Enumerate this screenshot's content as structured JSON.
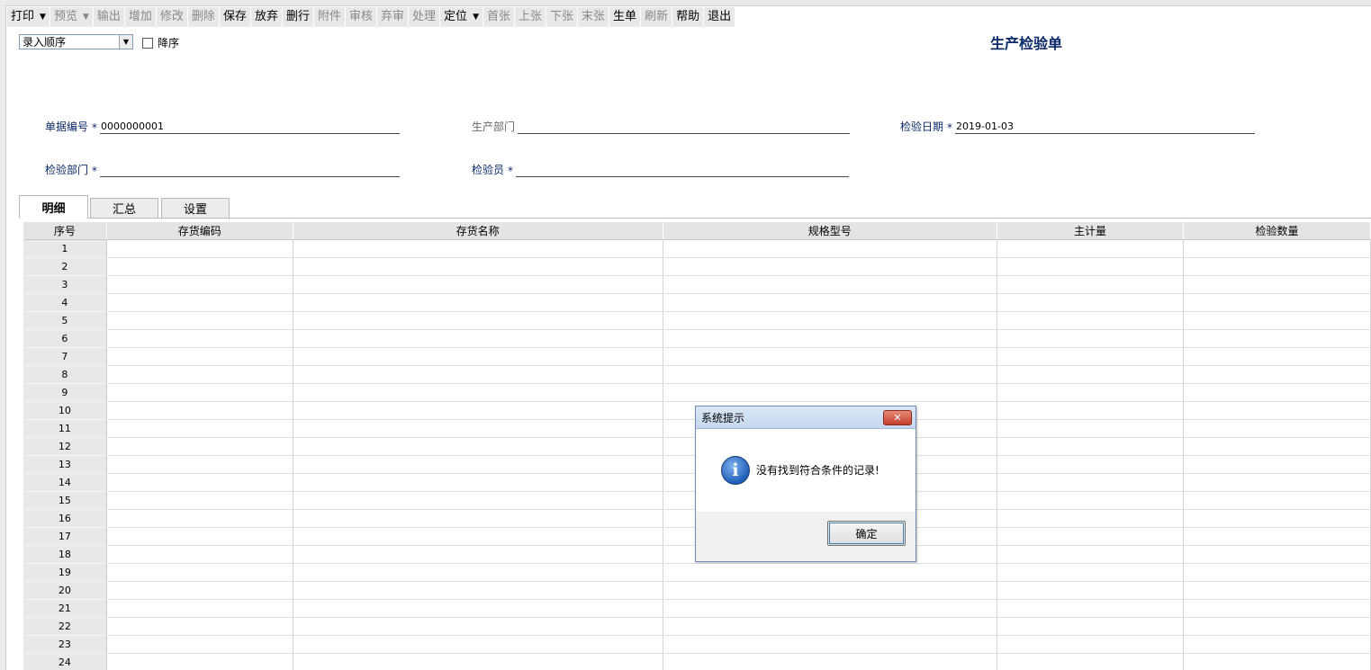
{
  "toolbar": {
    "items": [
      {
        "label": "打印",
        "dropdown": true,
        "enabled": true
      },
      {
        "label": "预览",
        "dropdown": true,
        "enabled": false
      },
      {
        "label": "输出",
        "enabled": false
      },
      {
        "label": "增加",
        "enabled": false
      },
      {
        "label": "修改",
        "enabled": false
      },
      {
        "label": "删除",
        "enabled": false
      },
      {
        "label": "保存",
        "enabled": true
      },
      {
        "label": "放弃",
        "enabled": true
      },
      {
        "label": "删行",
        "enabled": true
      },
      {
        "label": "附件",
        "enabled": false
      },
      {
        "label": "审核",
        "enabled": false
      },
      {
        "label": "弃审",
        "enabled": false
      },
      {
        "label": "处理",
        "enabled": false
      },
      {
        "label": "定位",
        "dropdown": true,
        "enabled": true
      },
      {
        "label": "首张",
        "enabled": false
      },
      {
        "label": "上张",
        "enabled": false
      },
      {
        "label": "下张",
        "enabled": false
      },
      {
        "label": "末张",
        "enabled": false
      },
      {
        "label": "生单",
        "enabled": true
      },
      {
        "label": "刷新",
        "enabled": false
      },
      {
        "label": "帮助",
        "enabled": true
      },
      {
        "label": "退出",
        "enabled": true
      }
    ]
  },
  "sort": {
    "selected": "录入顺序",
    "descending_label": "降序"
  },
  "document_title": "生产检验单",
  "fields": {
    "doc_no": {
      "label": "单据编号",
      "required": "*",
      "value": "0000000001"
    },
    "prod_dept": {
      "label": "生产部门",
      "value": ""
    },
    "inspect_date": {
      "label": "检验日期",
      "required": "*",
      "value": "2019-01-03"
    },
    "inspect_dept": {
      "label": "检验部门",
      "required": "*",
      "value": ""
    },
    "inspector": {
      "label": "检验员",
      "required": "*",
      "value": ""
    }
  },
  "tabs": [
    "明细",
    "汇总",
    "设置"
  ],
  "grid": {
    "columns": [
      "序号",
      "存货编码",
      "存货名称",
      "规格型号",
      "主计量",
      "检验数量"
    ],
    "rows": [
      "1",
      "2",
      "3",
      "4",
      "5",
      "6",
      "7",
      "8",
      "9",
      "10",
      "11",
      "12",
      "13",
      "14",
      "15",
      "16",
      "17",
      "18",
      "19",
      "20",
      "21",
      "22",
      "23",
      "24"
    ]
  },
  "dialog": {
    "title": "系统提示",
    "close_glyph": "✕",
    "icon": "info-icon",
    "icon_glyph": "i",
    "message": "没有找到符合条件的记录!",
    "ok_label": "确定"
  }
}
